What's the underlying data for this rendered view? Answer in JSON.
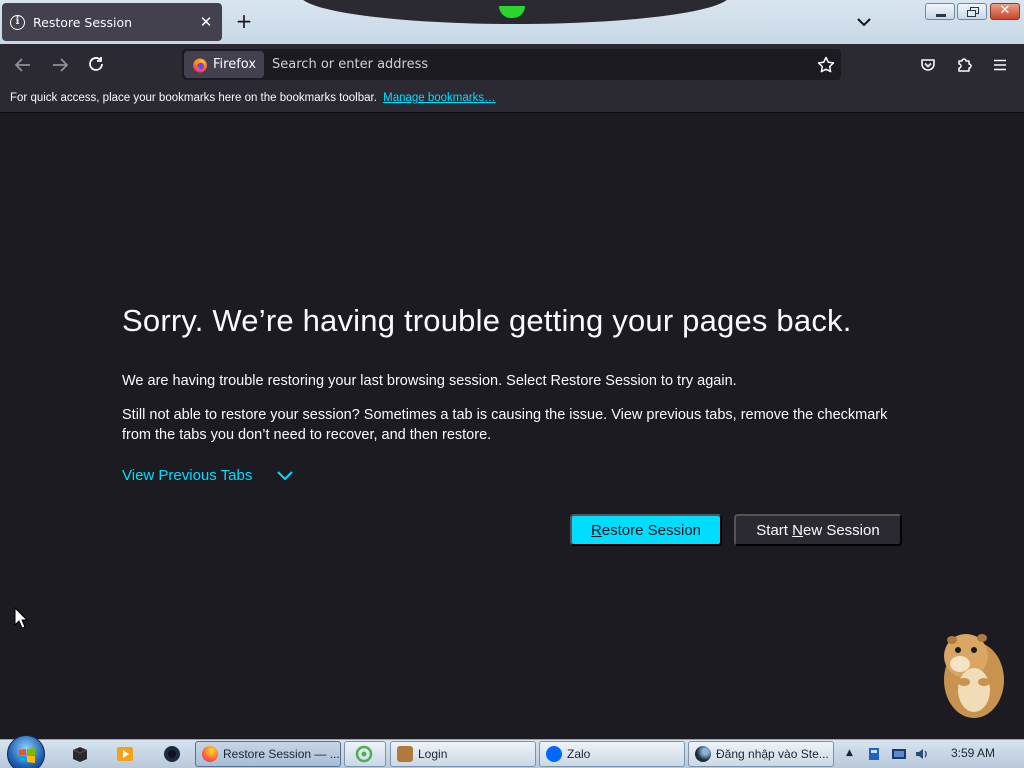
{
  "tab": {
    "title": "Restore Session",
    "close_glyph": "✕",
    "icon": "info-icon"
  },
  "new_tab_glyph": "+",
  "urlbar": {
    "identity_label": "Firefox",
    "placeholder": "Search or enter address"
  },
  "bookmarks_bar": {
    "message": "For quick access, place your bookmarks here on the bookmarks toolbar.",
    "link": "Manage bookmarks…"
  },
  "content": {
    "title": "Sorry. We’re having trouble getting your pages back.",
    "message_1": "We are having trouble restoring your last browsing session. Select Restore Session to try again.",
    "message_2": "Still not able to restore your session? Sometimes a tab is causing the issue. View previous tabs, remove the checkmark from the tabs you don’t need to recover, and then restore.",
    "view_tabs": "View Previous Tabs",
    "restore_button": {
      "accesskey": "R",
      "rest": "estore Session"
    },
    "start_new_button": {
      "before": "Start ",
      "accesskey": "N",
      "after": "ew Session"
    }
  },
  "taskbar": {
    "tasks": [
      {
        "label": "Restore Session — ...",
        "active": true
      },
      {
        "label": ""
      },
      {
        "label": "Login"
      },
      {
        "label": "Zalo"
      },
      {
        "label": "Đăng nhập vào Ste..."
      }
    ],
    "clock": "3:59 AM",
    "tray_arrow": "▲"
  },
  "colors": {
    "accent": "#00ddff",
    "content_bg": "#1c1b22",
    "toolbar_bg": "#2b2a33",
    "secondary_button_bg": "#2b2a33"
  }
}
